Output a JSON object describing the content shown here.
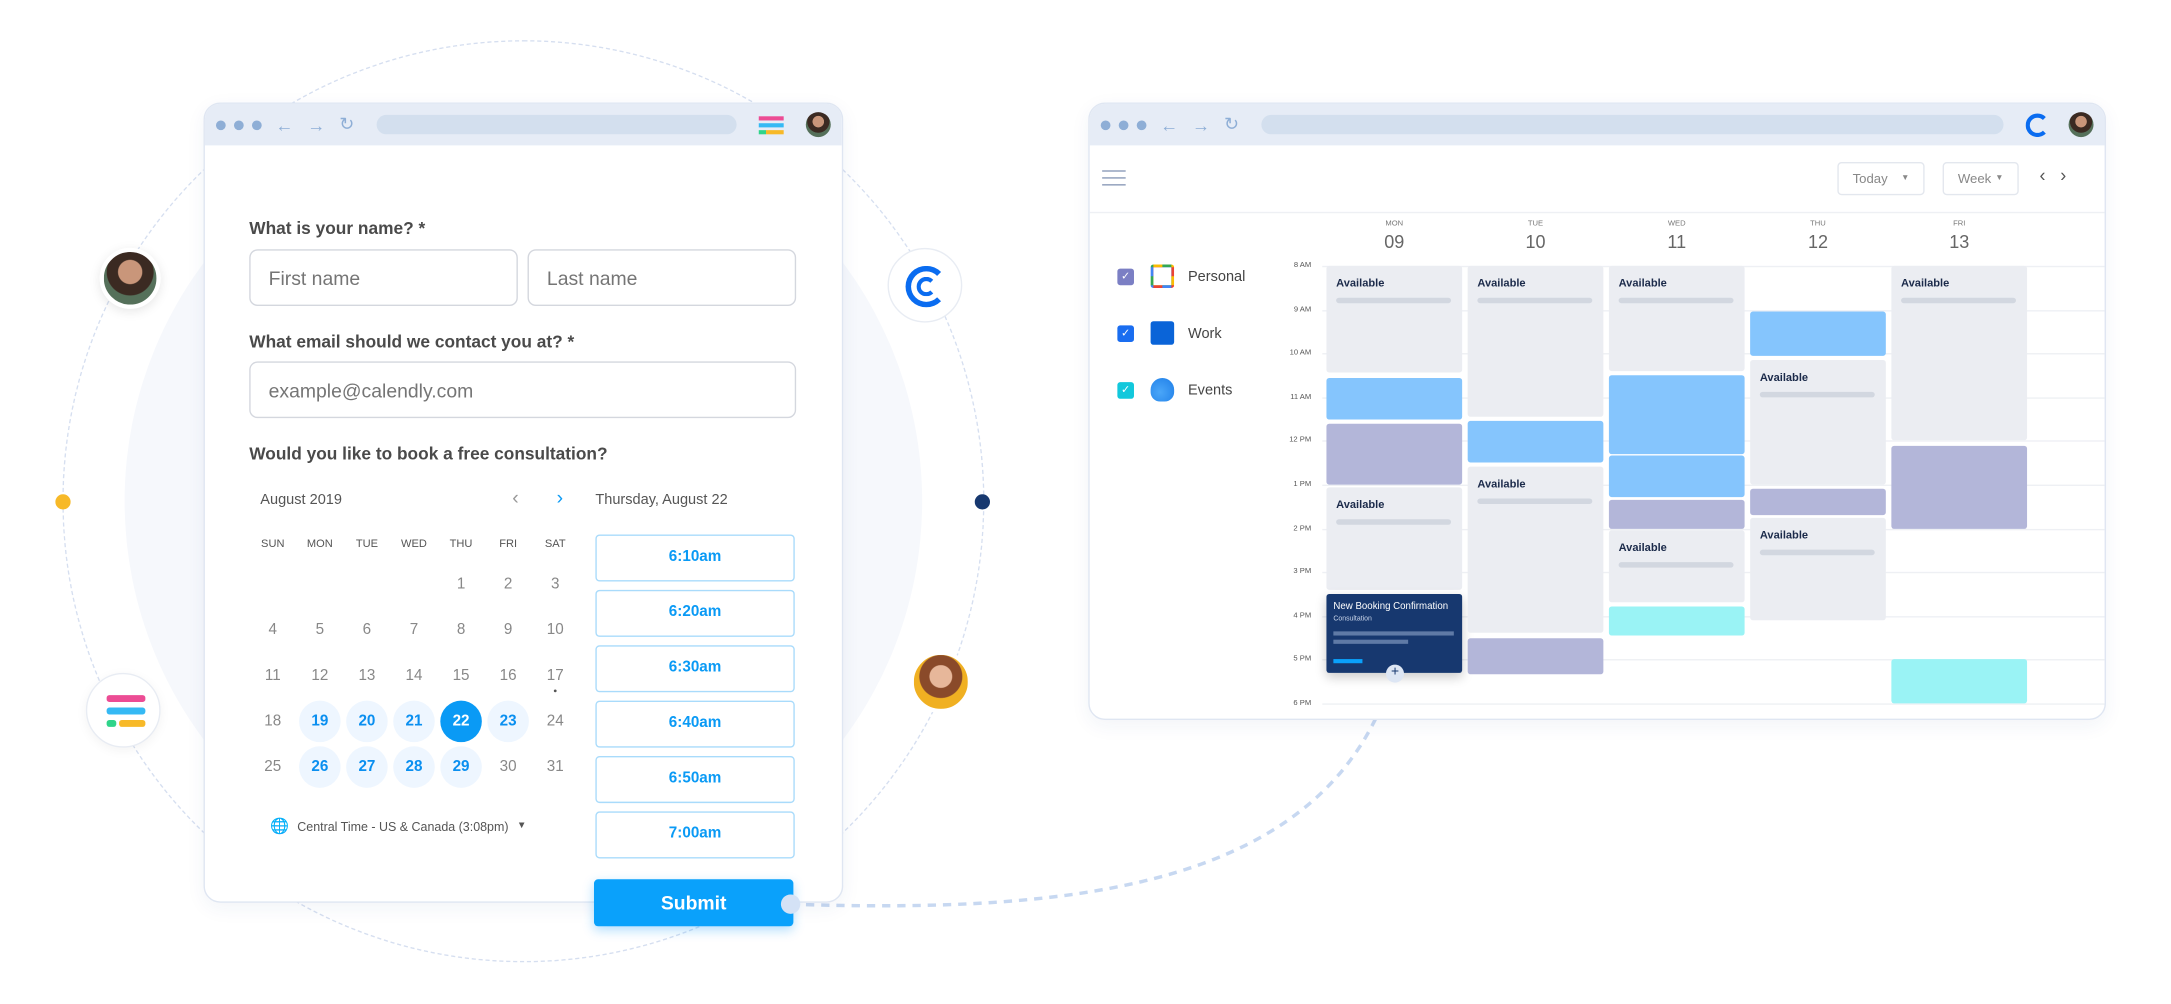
{
  "form": {
    "name_label": "What is your name? *",
    "first_placeholder": "First name",
    "last_placeholder": "Last name",
    "email_label": "What email should we contact you at? *",
    "email_placeholder": "example@calendly.com",
    "consult_label": "Would you like to book a free consultation?",
    "month": "August 2019",
    "selected_date": "Thursday, August 22",
    "weekdays": [
      "SUN",
      "MON",
      "TUE",
      "WED",
      "THU",
      "FRI",
      "SAT"
    ],
    "first_weekday_index": 4,
    "days_in_month": 31,
    "available_days": [
      19,
      20,
      21,
      23,
      26,
      27,
      28,
      29
    ],
    "selected_day": 22,
    "marked_day": 17,
    "timezone": "Central Time - US & Canada (3:08pm)",
    "time_slots": [
      "6:10am",
      "6:20am",
      "6:30am",
      "6:40am",
      "6:50am",
      "7:00am"
    ],
    "submit": "Submit"
  },
  "calendar": {
    "today": "Today",
    "view": "Week",
    "calendars": [
      {
        "name": "Personal",
        "color": "#7b7fc4",
        "icon": "google-calendar-icon"
      },
      {
        "name": "Work",
        "color": "#1a6df0",
        "icon": "outlook-icon"
      },
      {
        "name": "Events",
        "color": "#12c8dc",
        "icon": "icloud-icon"
      }
    ],
    "hours": [
      "8 AM",
      "9 AM",
      "10 AM",
      "11 AM",
      "12 PM",
      "1 PM",
      "2 PM",
      "3 PM",
      "4 PM",
      "5 PM",
      "6 PM"
    ],
    "days": [
      {
        "dow": "MON",
        "date": "09",
        "events": [
          {
            "type": "avail",
            "start": 8,
            "end": 10.45,
            "title": "Available"
          },
          {
            "type": "blue",
            "start": 10.55,
            "end": 11.5
          },
          {
            "type": "purple",
            "start": 11.6,
            "end": 13
          },
          {
            "type": "avail",
            "start": 13.05,
            "end": 15.4,
            "title": "Available"
          },
          {
            "type": "booking",
            "start": 15.5,
            "end": 17.3,
            "title": "New Booking Confirmation",
            "subtitle": "Consultation"
          }
        ]
      },
      {
        "dow": "TUE",
        "date": "10",
        "events": [
          {
            "type": "avail",
            "start": 8,
            "end": 11.45,
            "title": "Available"
          },
          {
            "type": "blue",
            "start": 11.55,
            "end": 12.5
          },
          {
            "type": "avail",
            "start": 12.6,
            "end": 16.4,
            "title": "Available"
          },
          {
            "type": "purple",
            "start": 16.5,
            "end": 17.35
          }
        ]
      },
      {
        "dow": "WED",
        "date": "11",
        "events": [
          {
            "type": "avail",
            "start": 8,
            "end": 10.4,
            "title": "Available"
          },
          {
            "type": "blue",
            "start": 10.5,
            "end": 12.3
          },
          {
            "type": "blue",
            "start": 12.35,
            "end": 13.3
          },
          {
            "type": "purple",
            "start": 13.35,
            "end": 14
          },
          {
            "type": "avail",
            "start": 14.05,
            "end": 15.7,
            "title": "Available"
          },
          {
            "type": "cyan",
            "start": 15.8,
            "end": 16.45
          }
        ]
      },
      {
        "dow": "THU",
        "date": "12",
        "events": [
          {
            "type": "blue",
            "start": 9.05,
            "end": 10.05
          },
          {
            "type": "avail",
            "start": 10.15,
            "end": 13,
            "title": "Available"
          },
          {
            "type": "purple",
            "start": 13.1,
            "end": 13.7
          },
          {
            "type": "avail",
            "start": 13.75,
            "end": 16.1,
            "title": "Available"
          }
        ]
      },
      {
        "dow": "FRI",
        "date": "13",
        "events": [
          {
            "type": "avail",
            "start": 8,
            "end": 12,
            "title": "Available"
          },
          {
            "type": "purple",
            "start": 12.1,
            "end": 14
          },
          {
            "type": "cyan",
            "start": 17,
            "end": 18
          }
        ]
      }
    ]
  },
  "colors": {
    "accent": "#0a9af5",
    "booking": "#17386f",
    "yellow_dot": "#f7b928",
    "navy_dot": "#17386f"
  }
}
